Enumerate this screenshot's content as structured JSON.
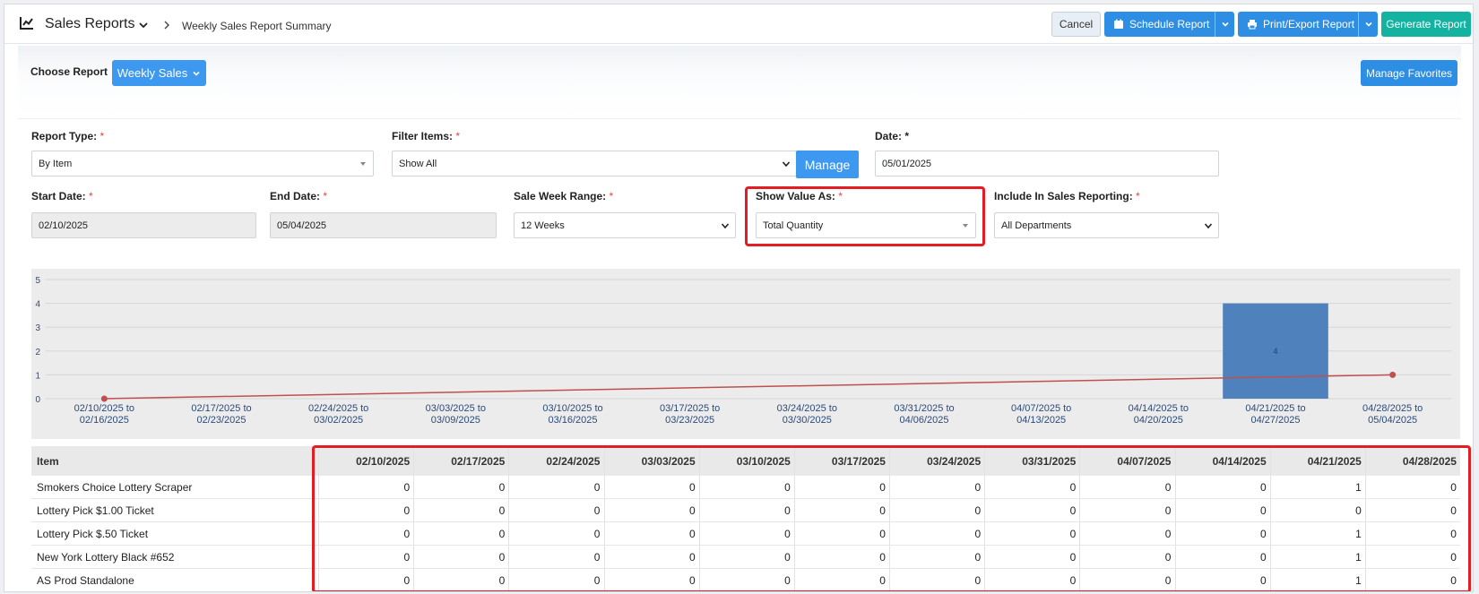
{
  "header": {
    "title": "Sales Reports",
    "breadcrumb": "Weekly Sales Report Summary",
    "cancel": "Cancel",
    "schedule": "Schedule Report",
    "print": "Print/Export Report",
    "generate": "Generate Report"
  },
  "chooser": {
    "label": "Choose Report",
    "selected": "Weekly Sales",
    "manage_favorites": "Manage Favorites"
  },
  "form": {
    "report_type": {
      "label": "Report Type:",
      "value": "By Item"
    },
    "filter_items": {
      "label": "Filter Items:",
      "value": "Show All",
      "manage": "Manage"
    },
    "date": {
      "label": "Date:",
      "value": "05/01/2025"
    },
    "start_date": {
      "label": "Start Date:",
      "value": "02/10/2025"
    },
    "end_date": {
      "label": "End Date:",
      "value": "05/04/2025"
    },
    "sale_week_range": {
      "label": "Sale Week Range:",
      "value": "12 Weeks"
    },
    "show_value_as": {
      "label": "Show Value As:",
      "value": "Total Quantity"
    },
    "include_in_sales": {
      "label": "Include In Sales Reporting:",
      "value": "All Departments"
    },
    "required_mark": "*"
  },
  "chart_data": {
    "type": "bar",
    "categories": [
      [
        "02/10/2025 to",
        "02/16/2025"
      ],
      [
        "02/17/2025 to",
        "02/23/2025"
      ],
      [
        "02/24/2025 to",
        "03/02/2025"
      ],
      [
        "03/03/2025 to",
        "03/09/2025"
      ],
      [
        "03/10/2025 to",
        "03/16/2025"
      ],
      [
        "03/17/2025 to",
        "03/23/2025"
      ],
      [
        "03/24/2025 to",
        "03/30/2025"
      ],
      [
        "03/31/2025 to",
        "04/06/2025"
      ],
      [
        "04/07/2025 to",
        "04/13/2025"
      ],
      [
        "04/14/2025 to",
        "04/20/2025"
      ],
      [
        "04/21/2025 to",
        "04/27/2025"
      ],
      [
        "04/28/2025 to",
        "05/04/2025"
      ]
    ],
    "values": [
      0,
      0,
      0,
      0,
      0,
      0,
      0,
      0,
      0,
      0,
      4,
      0
    ],
    "bar_label": "4",
    "trend": {
      "start": 0,
      "end": 1
    },
    "ylim": [
      0,
      5
    ],
    "yticks": [
      "0",
      "1",
      "2",
      "3",
      "4",
      "5"
    ],
    "grid": true,
    "colors": {
      "bar": "#4f81bd",
      "trend": "#c0504d",
      "background": "#ececec"
    }
  },
  "table": {
    "item_header": "Item",
    "columns": [
      "02/10/2025",
      "02/17/2025",
      "02/24/2025",
      "03/03/2025",
      "03/10/2025",
      "03/17/2025",
      "03/24/2025",
      "03/31/2025",
      "04/07/2025",
      "04/14/2025",
      "04/21/2025",
      "04/28/2025"
    ],
    "rows": [
      {
        "item": "Smokers Choice Lottery Scraper",
        "values": [
          "0",
          "0",
          "0",
          "0",
          "0",
          "0",
          "0",
          "0",
          "0",
          "0",
          "1",
          "0"
        ]
      },
      {
        "item": "Lottery Pick $1.00 Ticket",
        "values": [
          "0",
          "0",
          "0",
          "0",
          "0",
          "0",
          "0",
          "0",
          "0",
          "0",
          "0",
          "0"
        ]
      },
      {
        "item": "Lottery Pick $.50 Ticket",
        "values": [
          "0",
          "0",
          "0",
          "0",
          "0",
          "0",
          "0",
          "0",
          "0",
          "0",
          "1",
          "0"
        ]
      },
      {
        "item": "New York Lottery Black #652",
        "values": [
          "0",
          "0",
          "0",
          "0",
          "0",
          "0",
          "0",
          "0",
          "0",
          "0",
          "1",
          "0"
        ]
      },
      {
        "item": "AS Prod Standalone",
        "values": [
          "0",
          "0",
          "0",
          "0",
          "0",
          "0",
          "0",
          "0",
          "0",
          "0",
          "1",
          "0"
        ]
      }
    ]
  },
  "colors": {
    "primary": "#2d8ee4",
    "teal": "#14b3a1",
    "highlight": "#e51c23"
  }
}
